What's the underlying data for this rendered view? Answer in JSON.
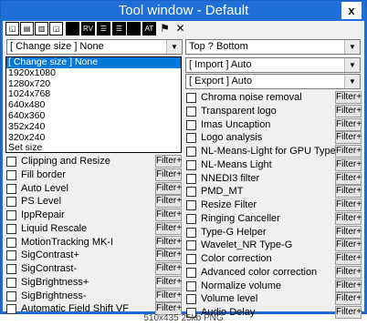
{
  "window": {
    "title": "Tool window - Default",
    "close_label": "x"
  },
  "toolbar": {
    "buttons": [
      {
        "name": "toolbar-button-1",
        "label": "◱"
      },
      {
        "name": "toolbar-button-2",
        "label": "▤"
      },
      {
        "name": "toolbar-button-3",
        "label": "▥"
      },
      {
        "name": "toolbar-button-4",
        "label": "◲"
      },
      {
        "name": "toolbar-button-5",
        "label": ""
      },
      {
        "name": "toolbar-button-rv",
        "label": "RV"
      },
      {
        "name": "toolbar-button-7",
        "label": "☰"
      },
      {
        "name": "toolbar-button-8",
        "label": "☰"
      },
      {
        "name": "toolbar-button-9",
        "label": ""
      },
      {
        "name": "toolbar-button-at",
        "label": "AT"
      },
      {
        "name": "flag-icon",
        "label": "⚑"
      },
      {
        "name": "close-x-icon",
        "label": "✕"
      }
    ]
  },
  "combos": {
    "size": "[ Change size ] None",
    "position": "Top ? Bottom",
    "import": "[ Import ] Auto",
    "export": "[ Export ] Auto"
  },
  "size_options": [
    "[ Change size ] None",
    "1920x1080",
    "1280x720",
    "1024x768",
    "640x480",
    "640x360",
    "352x240",
    "320x240",
    "Set size"
  ],
  "filter_button_label": "Filter+",
  "left_filters": [
    "Clipping and Resize",
    "Fill border",
    "Auto Level",
    "PS Level",
    "IppRepair",
    "Liquid Rescale",
    "MotionTracking MK-I",
    "SigContrast+",
    "SigContrast-",
    "SigBrightness+",
    "SigBrightness-",
    "Automatic Field Shift VF"
  ],
  "right_filters": [
    "Chroma noise removal",
    "Transparent logo",
    "Imas Uncaption",
    "Logo analysis",
    "NL-Means-Light for GPU TypeC",
    "NL-Means Light",
    "NNEDI3 filter",
    "PMD_MT",
    "Resize Filter",
    "Ringing Canceller",
    "Type-G Helper",
    "Wavelet_NR Type-G",
    "Color correction",
    "Advanced color correction",
    "Normalize volume",
    "Volume level",
    "Audio Delay"
  ],
  "status_caption": "510x435 25kb PNG"
}
